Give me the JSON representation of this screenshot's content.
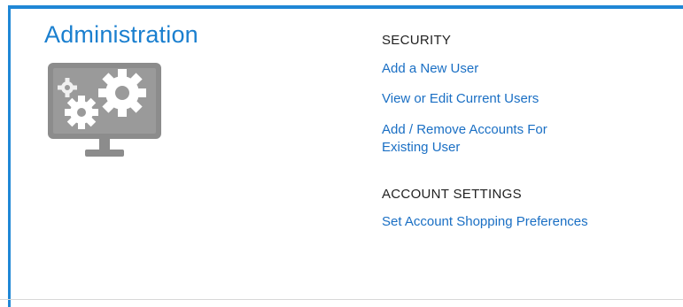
{
  "admin": {
    "title": "Administration",
    "icon": "monitor-gears-icon"
  },
  "security": {
    "heading": "SECURITY",
    "links": [
      "Add a New User",
      "View or Edit Current Users",
      "Add / Remove Accounts For Existing User"
    ]
  },
  "account_settings": {
    "heading": "ACCOUNT SETTINGS",
    "links": [
      "Set Account Shopping Preferences"
    ]
  },
  "colors": {
    "accent": "#1f87d6",
    "link": "#1a6fc4",
    "icon_gray": "#8c8c8c"
  }
}
